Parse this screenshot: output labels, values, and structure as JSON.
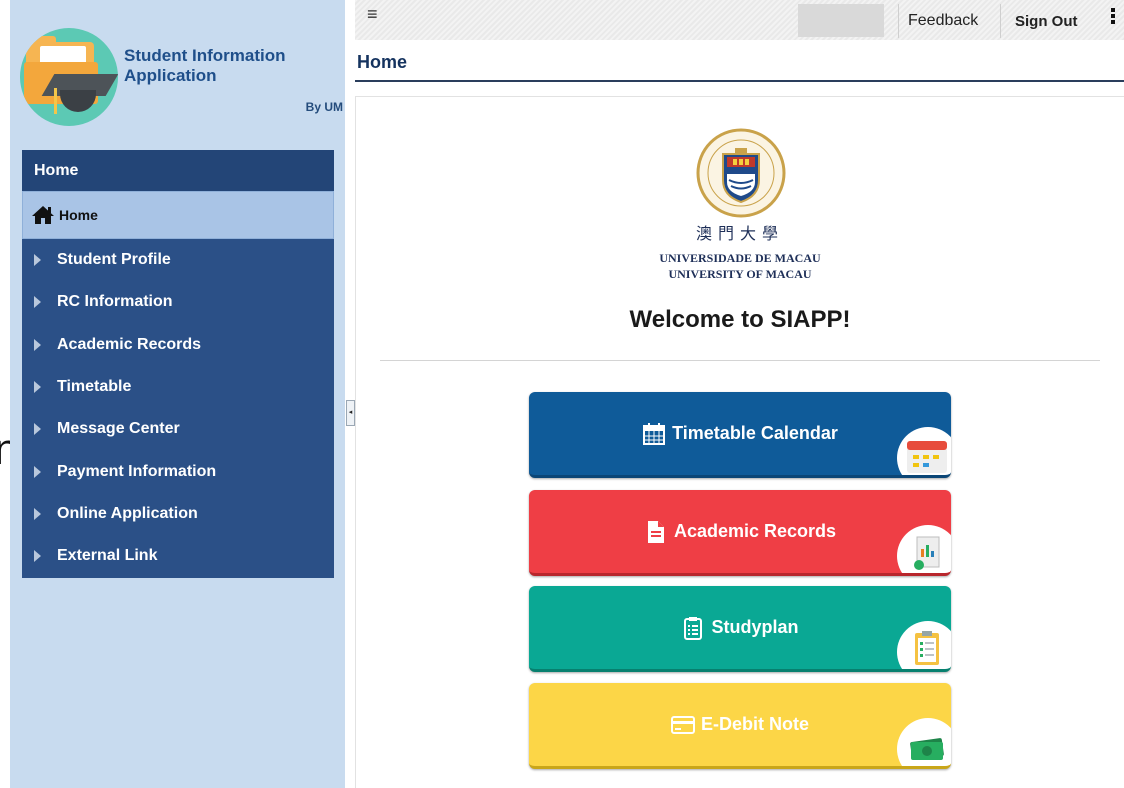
{
  "stray": {
    "glyph": "n"
  },
  "brand": {
    "title": "Student Information Application",
    "by": "By UM"
  },
  "sidebar": {
    "header": "Home",
    "active_item": "Home",
    "items": [
      {
        "label": "Student Profile"
      },
      {
        "label": "RC Information"
      },
      {
        "label": "Academic Records"
      },
      {
        "label": "Timetable"
      },
      {
        "label": "Message Center"
      },
      {
        "label": "Payment Information"
      },
      {
        "label": "Online Application"
      },
      {
        "label": "External Link"
      }
    ]
  },
  "topbar": {
    "menu_icon": "hamburger-icon",
    "feedback": "Feedback",
    "sign_out": "Sign Out",
    "more_icon": "more-vertical-icon"
  },
  "page": {
    "title": "Home"
  },
  "university": {
    "chinese": "澳門大學",
    "portuguese": "UNIVERSIDADE DE MACAU",
    "english": "UNIVERSITY OF MACAU"
  },
  "welcome": "Welcome to SIAPP!",
  "tiles": [
    {
      "label": "Timetable Calendar",
      "icon": "calendar-icon",
      "color": "#0f5b99"
    },
    {
      "label": "Academic Records",
      "icon": "document-icon",
      "color": "#ef3e45"
    },
    {
      "label": "Studyplan",
      "icon": "clipboard-list-icon",
      "color": "#0aa894"
    },
    {
      "label": "E-Debit Note",
      "icon": "credit-card-icon",
      "color": "#fcd647"
    }
  ]
}
